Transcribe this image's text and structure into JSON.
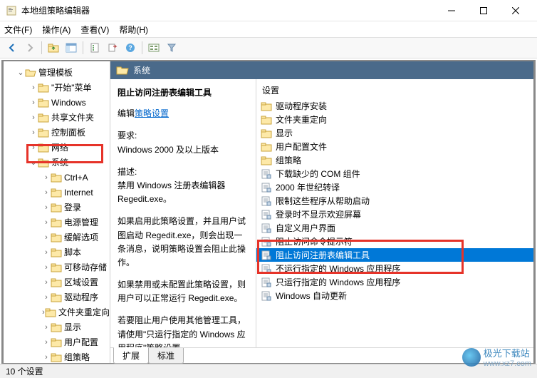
{
  "window": {
    "title": "本地组策略编辑器"
  },
  "menu": {
    "file": "文件(F)",
    "action": "操作(A)",
    "view": "查看(V)",
    "help": "帮助(H)"
  },
  "tree": {
    "root": "管理模板",
    "items": [
      "\"开始\"菜单",
      "Windows",
      "共享文件夹",
      "控制面板",
      "网络",
      "系统",
      "Ctrl+A",
      "Internet",
      "登录",
      "电源管理",
      "缓解选项",
      "脚本",
      "可移动存储",
      "区域设置",
      "驱动程序",
      "文件夹重定向",
      "显示",
      "用户配置",
      "组策略"
    ]
  },
  "right": {
    "header_title": "系统",
    "detail": {
      "title": "阻止访问注册表编辑工具",
      "edit": "编辑",
      "link": "策略设置",
      "req_label": "要求:",
      "req_text": "Windows 2000 及以上版本",
      "desc_label": "描述:",
      "desc_text": "禁用 Windows 注册表编辑器 Regedit.exe。",
      "para1": "如果启用此策略设置，并且用户试图启动 Regedit.exe，则会出现一条消息，说明策略设置会阻止此操作。",
      "para2": "如果禁用或未配置此策略设置，则用户可以正常运行 Regedit.exe。",
      "para3": "若要阻止用户使用其他管理工具，请使用\"只运行指定的 Windows 应用程序\"策略设置。"
    },
    "list_header": "设置",
    "list": [
      {
        "icon": "folder",
        "text": "驱动程序安装"
      },
      {
        "icon": "folder",
        "text": "文件夹重定向"
      },
      {
        "icon": "folder",
        "text": "显示"
      },
      {
        "icon": "folder",
        "text": "用户配置文件"
      },
      {
        "icon": "folder",
        "text": "组策略"
      },
      {
        "icon": "setting",
        "text": "下载缺少的 COM 组件"
      },
      {
        "icon": "setting",
        "text": "2000 年世纪转译"
      },
      {
        "icon": "setting",
        "text": "限制这些程序从帮助启动"
      },
      {
        "icon": "setting",
        "text": "登录时不显示欢迎屏幕"
      },
      {
        "icon": "setting",
        "text": "自定义用户界面"
      },
      {
        "icon": "setting",
        "text": "阻止访问命令提示符"
      },
      {
        "icon": "setting",
        "text": "阻止访问注册表编辑工具",
        "selected": true
      },
      {
        "icon": "setting",
        "text": "不运行指定的 Windows 应用程序"
      },
      {
        "icon": "setting",
        "text": "只运行指定的 Windows 应用程序"
      },
      {
        "icon": "setting",
        "text": "Windows 自动更新"
      }
    ],
    "tabs": {
      "extended": "扩展",
      "standard": "标准"
    }
  },
  "status": "10 个设置",
  "watermark": {
    "name": "极光下载站",
    "url": "www.xz7.com"
  },
  "colors": {
    "selection": "#0078d7",
    "highlight": "#e63329",
    "header": "#4a6a8a"
  }
}
